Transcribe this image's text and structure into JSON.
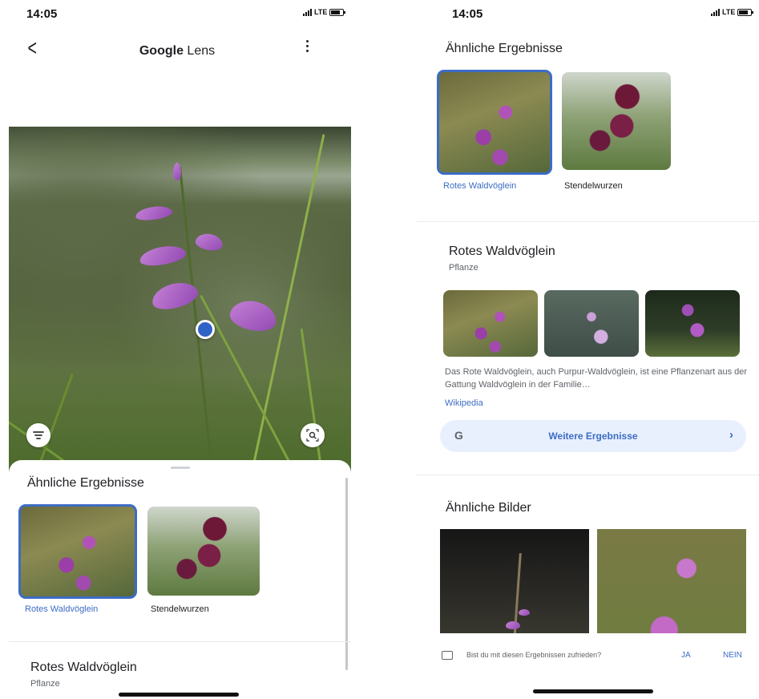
{
  "left": {
    "status": {
      "time": "14:05",
      "network": "LTE"
    },
    "header": {
      "title_brand": "Google",
      "title_product": "Lens"
    },
    "sheet": {
      "section_title": "Ähnliche Ergebnisse",
      "results": [
        {
          "label": "Rotes Waldvöglein",
          "selected": true
        },
        {
          "label": "Stendelwurzen",
          "selected": false
        }
      ],
      "entity": {
        "title": "Rotes Waldvöglein",
        "subtitle": "Pflanze"
      }
    }
  },
  "right": {
    "status": {
      "time": "14:05",
      "network": "LTE"
    },
    "similar_results": {
      "title": "Ähnliche Ergebnisse",
      "results": [
        {
          "label": "Rotes Waldvöglein",
          "selected": true
        },
        {
          "label": "Stendelwurzen",
          "selected": false
        }
      ]
    },
    "entity": {
      "title": "Rotes Waldvöglein",
      "subtitle": "Pflanze",
      "description": "Das Rote Waldvöglein, auch Purpur-Waldvöglein, ist eine Pflanzenart aus der Gattung Waldvöglein in der Familie…",
      "source": "Wikipedia",
      "more_button": {
        "logo": "G",
        "label": "Weitere Ergebnisse",
        "chevron": "›"
      }
    },
    "similar_images": {
      "title": "Ähnliche Bilder"
    },
    "feedback": {
      "question": "Bist du mit diesen Ergebnissen zufrieden?",
      "yes": "JA",
      "no": "NEIN"
    }
  },
  "colors": {
    "accent": "#3d6cc4",
    "text": "#202124",
    "secondary": "#5f6368",
    "button_bg": "#e8f0fe"
  },
  "icons": [
    "back-arrow-icon",
    "more-vert-icon",
    "filter-icon",
    "lens-search-icon",
    "google-g-icon",
    "chevron-right-icon",
    "feedback-icon",
    "signal-icon",
    "battery-icon"
  ]
}
